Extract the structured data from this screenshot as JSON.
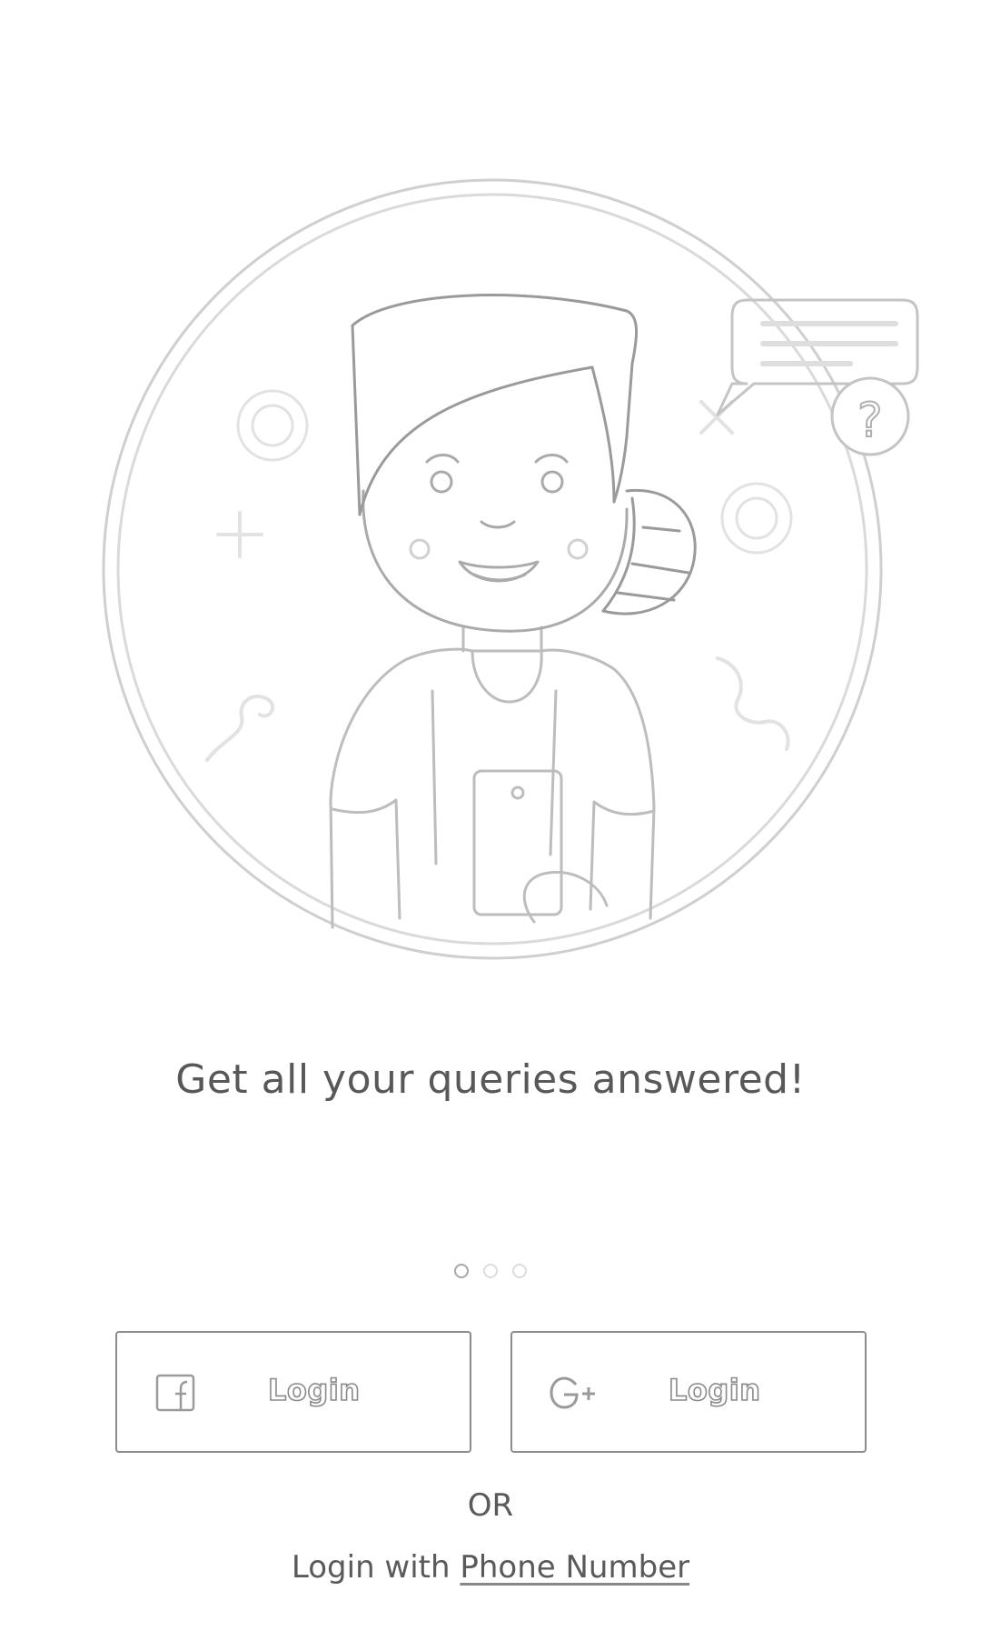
{
  "onboarding": {
    "headline": "Get all your queries answered!",
    "pager": {
      "total": 3,
      "active_index": 0
    }
  },
  "illustration": {
    "speech_bubble_icon": "question-mark-icon",
    "question_mark": "?"
  },
  "buttons": {
    "facebook": {
      "icon": "facebook-icon",
      "icon_glyph": "f",
      "label": "Login"
    },
    "google": {
      "icon": "google-plus-icon",
      "icon_glyph": "G+",
      "label": "Login"
    }
  },
  "alternate": {
    "or_label": "OR",
    "prefix": "Login with",
    "link_label": "Phone Number"
  },
  "colors": {
    "background": "#ffffff",
    "line": "#c8c8c8",
    "text": "#555555",
    "button_border": "#8c8c8c"
  }
}
